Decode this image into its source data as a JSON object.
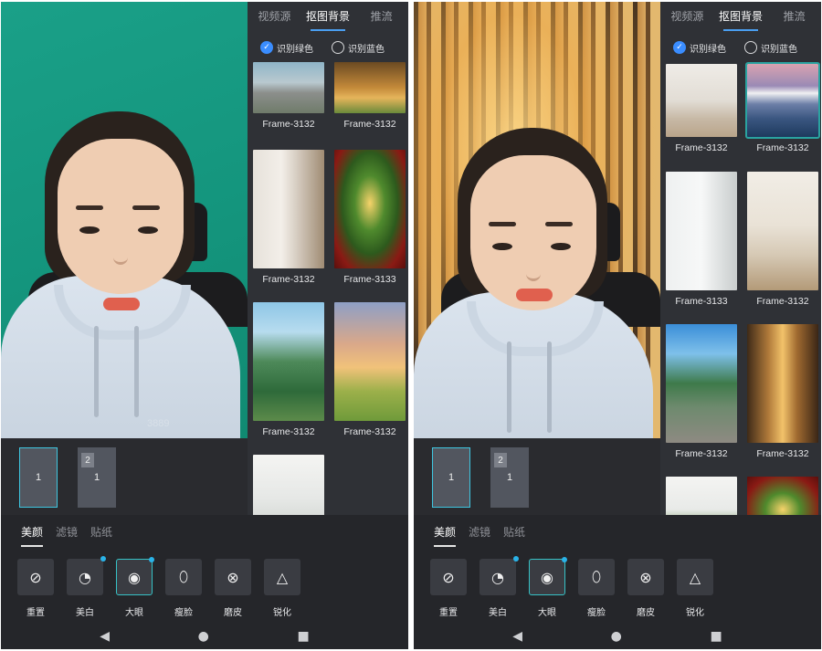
{
  "panel": {
    "tabs": [
      "视频源",
      "抠图背景",
      "推流"
    ],
    "active_tab": 1,
    "options": [
      "识别绿色",
      "识别蓝色"
    ]
  },
  "left": {
    "thumbnails": [
      {
        "caption": "Frame-3132",
        "kind": "road"
      },
      {
        "caption": "Frame-3132",
        "kind": "forest-warm"
      },
      {
        "caption": "Frame-3132",
        "kind": "room-chair"
      },
      {
        "caption": "Frame-3133",
        "kind": "christmas-tree"
      },
      {
        "caption": "Frame-3132",
        "kind": "anime-forest"
      },
      {
        "caption": "Frame-3132",
        "kind": "sunset-field"
      },
      {
        "caption": "",
        "kind": "bright-room"
      }
    ],
    "layers": [
      {
        "label": "1",
        "badge": ""
      },
      {
        "label": "1",
        "badge": "2"
      }
    ]
  },
  "right": {
    "thumbnails": [
      {
        "caption": "Frame-3132",
        "kind": "living-room"
      },
      {
        "caption": "Frame-3132",
        "kind": "mount-fuji",
        "selected": true
      },
      {
        "caption": "Frame-3133",
        "kind": "white-room"
      },
      {
        "caption": "Frame-3132",
        "kind": "beige-room"
      },
      {
        "caption": "Frame-3132",
        "kind": "anime-street"
      },
      {
        "caption": "Frame-3132",
        "kind": "forest-sun"
      },
      {
        "caption": "",
        "kind": "bright-room"
      },
      {
        "caption": "",
        "kind": "christmas-tree"
      }
    ],
    "layers": [
      {
        "label": "1",
        "badge": ""
      },
      {
        "label": "1",
        "badge": "2"
      }
    ]
  },
  "beauty": {
    "tabs": [
      "美颜",
      "滤镜",
      "贴纸"
    ],
    "tools": [
      {
        "label": "重置",
        "icon": "reset-icon",
        "dot": false
      },
      {
        "label": "美白",
        "icon": "whitening-icon",
        "dot": true
      },
      {
        "label": "大眼",
        "icon": "big-eye-icon",
        "dot": true
      },
      {
        "label": "瘦脸",
        "icon": "slim-face-icon",
        "dot": false
      },
      {
        "label": "磨皮",
        "icon": "smooth-skin-icon",
        "dot": false
      },
      {
        "label": "锐化",
        "icon": "sharpen-icon",
        "dot": false
      }
    ],
    "selected_tool": 2
  },
  "watermark": "3889",
  "colors": {
    "accent": "#36c2c6",
    "tab_underline": "#4a9ef0",
    "green_screen": "#1aa088"
  }
}
